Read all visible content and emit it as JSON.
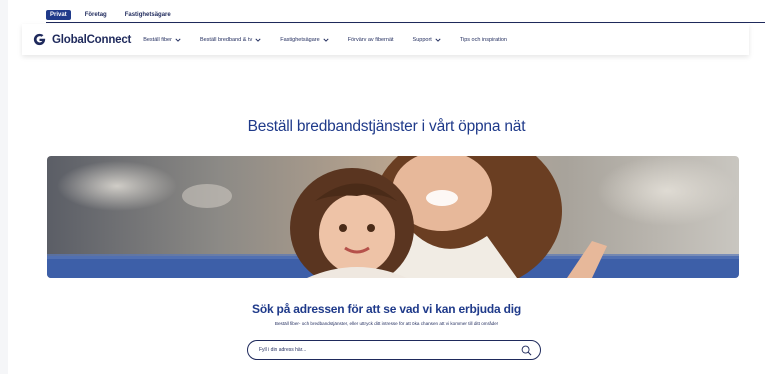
{
  "audience_tabs": [
    {
      "label": "Privat",
      "active": true
    },
    {
      "label": "Företag",
      "active": false
    },
    {
      "label": "Fastighetsägare",
      "active": false
    }
  ],
  "brand": {
    "name": "GlobalConnect",
    "logo_icon": "globalconnect-g-logo",
    "color": "#1f2a5c",
    "accent": "#1f3a8a"
  },
  "nav": {
    "items": [
      {
        "label": "Beställ fiber",
        "has_dropdown": true
      },
      {
        "label": "Beställ bredband & tv",
        "has_dropdown": true
      },
      {
        "label": "Fastighetsägare",
        "has_dropdown": true
      },
      {
        "label": "Förvärv av fibernät",
        "has_dropdown": false
      },
      {
        "label": "Support",
        "has_dropdown": true
      },
      {
        "label": "Tips och inspiration",
        "has_dropdown": false
      }
    ]
  },
  "hero": {
    "title": "Beställ bredbandstjänster i vårt öppna nät",
    "image_alt": "mother-and-daughter-photo"
  },
  "search": {
    "title": "Sök på adressen för att se vad vi kan erbjuda dig",
    "subtitle": "Beställ fiber- och bredbandstjänster, eller uttryck ditt intresse för att öka chansen att vi kommer till ditt område!",
    "placeholder": "Fyll i din adress här...",
    "value": "",
    "icon": "search-icon"
  }
}
